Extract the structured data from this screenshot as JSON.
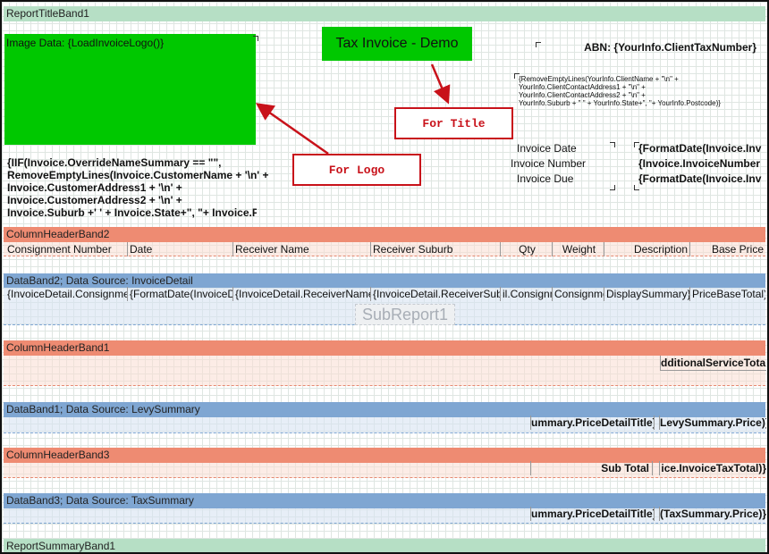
{
  "report_title_band": "ReportTitleBand1",
  "logo_label": "Image Data: {LoadInvoiceLogo()}",
  "title_text": "Tax Invoice - Demo",
  "abn_text": "ABN: {YourInfo.ClientTaxNumber}",
  "client_address_lines": [
    "{RemoveEmptyLines(YourInfo.ClientName + \"\\n\" +",
    "YourInfo.ClientContactAddress1 + \"\\n\" +",
    "YourInfo.ClientContactAddress2 + \"\\n\" +",
    "YourInfo.Suburb + \" \" + YourInfo.State+\", \"+ YourInfo.Postcode)}"
  ],
  "customer_lines": [
    "{IIF(Invoice.OverrideNameSummary == \"\",",
    "RemoveEmptyLines(Invoice.CustomerName + '\\n' +",
    "Invoice.CustomerAddress1 + '\\n' +",
    "Invoice.CustomerAddress2 + '\\n' +",
    "Invoice.Suburb +' ' + Invoice.State+\", \"+ Invoice.Po"
  ],
  "invoice_labels": [
    "Invoice Date",
    "Invoice Number",
    "Invoice Due"
  ],
  "invoice_values": [
    "{FormatDate(Invoice.Inv",
    "{Invoice.InvoiceNumber",
    "{FormatDate(Invoice.Inv"
  ],
  "callouts": {
    "title": "For Title",
    "logo": "For Logo"
  },
  "column_header_band2": "ColumnHeaderBand2",
  "column_headers": [
    "Consignment Number",
    "Date",
    "Receiver Name",
    "Receiver Suburb",
    "Qty",
    "Weight",
    "Description",
    "Base Price"
  ],
  "data_band2": "DataBand2; Data Source: InvoiceDetail",
  "detail_cells": [
    "{InvoiceDetail.Consignme",
    "{FormatDate(InvoiceD",
    "{InvoiceDetail.ReceiverName",
    "{InvoiceDetail.ReceiverSubu",
    "il.Consignm",
    "Consignme",
    "DisplaySummary}",
    "PriceBaseTotal)}"
  ],
  "subreport_label": "SubReport1",
  "column_header_band1": "ColumnHeaderBand1",
  "additional_service_total": "dditionalServiceTotal)}",
  "data_band1": "DataBand1; Data Source: LevySummary",
  "levy_detail_title": "ummary.PriceDetailTitle}",
  "levy_price": "LevySummary.Price)}",
  "column_header_band3": "ColumnHeaderBand3",
  "sub_total_label": "Sub Total",
  "invoice_tax_total": "ice.InvoiceTaxTotal)}",
  "data_band3": "DataBand3; Data Source: TaxSummary",
  "tax_detail_title": "ummary.PriceDetailTitle}",
  "tax_price": "(TaxSummary.Price)}",
  "report_summary_band": "ReportSummaryBand1",
  "colors": {
    "band_green": "#b6dfc5",
    "band_red": "#ee8b72",
    "band_blue": "#7fa6d2",
    "title_green": "#00c800",
    "callout_red": "#c8121a"
  }
}
